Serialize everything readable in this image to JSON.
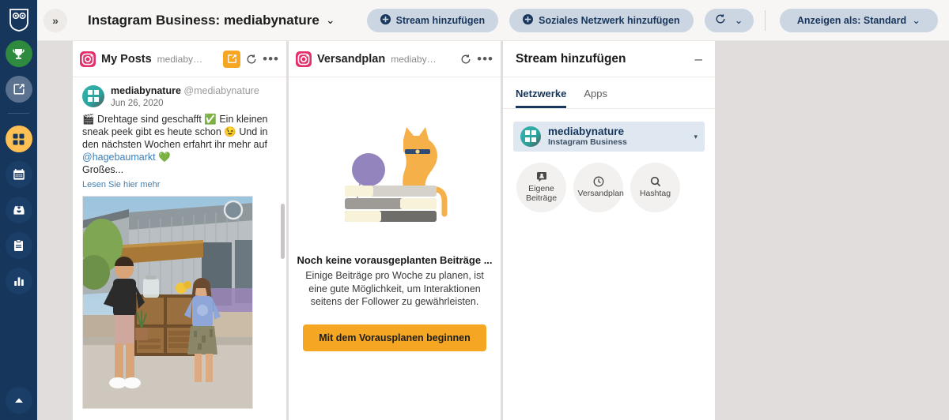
{
  "rail": {
    "logo": "hootsuite-owl-logo",
    "items": [
      {
        "name": "rewards-trophy",
        "icon": "trophy-icon"
      },
      {
        "name": "compose",
        "icon": "compose-icon"
      },
      {
        "name": "streams",
        "icon": "streams-grid-icon"
      },
      {
        "name": "planner",
        "icon": "calendar-icon"
      },
      {
        "name": "inbox",
        "icon": "inbox-icon"
      },
      {
        "name": "content",
        "icon": "clipboard-icon"
      },
      {
        "name": "analytics",
        "icon": "bar-chart-icon"
      }
    ],
    "bottom": {
      "name": "expand-up",
      "icon": "chevron-up-icon"
    }
  },
  "topbar": {
    "collapse_label": "»",
    "board_title": "Instagram Business: mediabynature",
    "board_caret": "⌄",
    "add_stream_label": "Stream hinzufügen",
    "add_social_network_label": "Soziales Netzwerk hinzufügen",
    "refresh_icon": "refresh-icon",
    "refresh_caret": "⌄",
    "view_as_label": "Anzeigen als: Standard",
    "view_as_caret": "⌄"
  },
  "streams": [
    {
      "network_icon": "instagram-icon",
      "title": "My Posts",
      "account": "mediaby…",
      "has_compose": true,
      "compose_icon": "compose-icon",
      "refresh_icon": "refresh-icon",
      "more_icon": "more-dots-icon",
      "post": {
        "avatar": "mediabynature-avatar",
        "username": "mediabynature",
        "handle": "@mediabynature",
        "date": "Jun 26, 2020",
        "text_part1": "🎬 Drehtage sind geschafft ✅ Ein kleinen sneak peek gibt es heute schon 😉 Und in den nächsten Wochen erfahrt ihr mehr auf ",
        "mention": "@hagebaumarkt",
        "text_part2": " 💚",
        "text_part3": "Großes...",
        "read_more": "Lesen Sie hier mehr",
        "photo_alt": "Zwei Personen vor einem Haus mit Holzregal"
      }
    },
    {
      "network_icon": "instagram-icon",
      "title": "Versandplan",
      "account": "mediaby…",
      "has_compose": false,
      "refresh_icon": "refresh-icon",
      "more_icon": "more-dots-icon",
      "empty": {
        "illustration": "cat-on-books-illustration",
        "title": "Noch keine vorausgeplanten Beiträge ...",
        "description": "Einige Beiträge pro Woche zu planen, ist eine gute Möglichkeit, um Interaktionen seitens der Follower zu gewährleisten.",
        "cta_label": "Mit dem Vorausplanen beginnen"
      }
    }
  ],
  "add_stream_panel": {
    "title": "Stream hinzufügen",
    "minimize_label": "–",
    "tabs": [
      {
        "label": "Netzwerke",
        "active": true
      },
      {
        "label": "Apps",
        "active": false
      }
    ],
    "account": {
      "avatar": "mediabynature-avatar",
      "name": "mediabynature",
      "type": "Instagram Business",
      "caret": "▾"
    },
    "stream_types": [
      {
        "label": "Eigene Beiträge",
        "icon": "own-posts-icon"
      },
      {
        "label": "Versandplan",
        "icon": "clock-icon"
      },
      {
        "label": "Hashtag",
        "icon": "search-icon"
      }
    ]
  },
  "colors": {
    "rail_bg": "#16365c",
    "accent_orange": "#f5a623",
    "pill_bg": "#ccd6e2",
    "instagram_pink": "#e1306c",
    "canvas_bg": "#e1dddc",
    "topbar_bg": "#f7f6f4"
  }
}
